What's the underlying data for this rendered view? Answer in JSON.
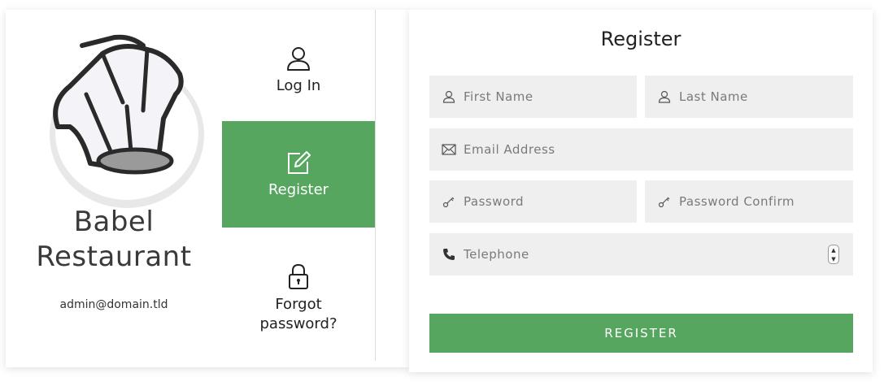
{
  "brand": {
    "name_line1": "Babel",
    "name_line2": "Restaurant",
    "email": "admin@domain.tld",
    "logo_icon": "chef-hat-icon"
  },
  "nav": {
    "login": {
      "label": "Log In",
      "icon": "user-icon"
    },
    "register": {
      "label": "Register",
      "icon": "edit-icon",
      "active": true
    },
    "forgot": {
      "label_line1": "Forgot",
      "label_line2": "password?",
      "icon": "lock-icon"
    }
  },
  "form": {
    "title": "Register",
    "first_name": {
      "placeholder": "First Name",
      "value": ""
    },
    "last_name": {
      "placeholder": "Last Name",
      "value": ""
    },
    "email": {
      "placeholder": "Email Address",
      "value": ""
    },
    "password": {
      "placeholder": "Password",
      "value": ""
    },
    "password_confirm": {
      "placeholder": "Password Confirm",
      "value": ""
    },
    "telephone": {
      "placeholder": "Telephone",
      "value": ""
    },
    "submit_label": "REGISTER"
  },
  "colors": {
    "accent": "#56a660",
    "field_bg": "#efefef",
    "text": "#222222"
  }
}
